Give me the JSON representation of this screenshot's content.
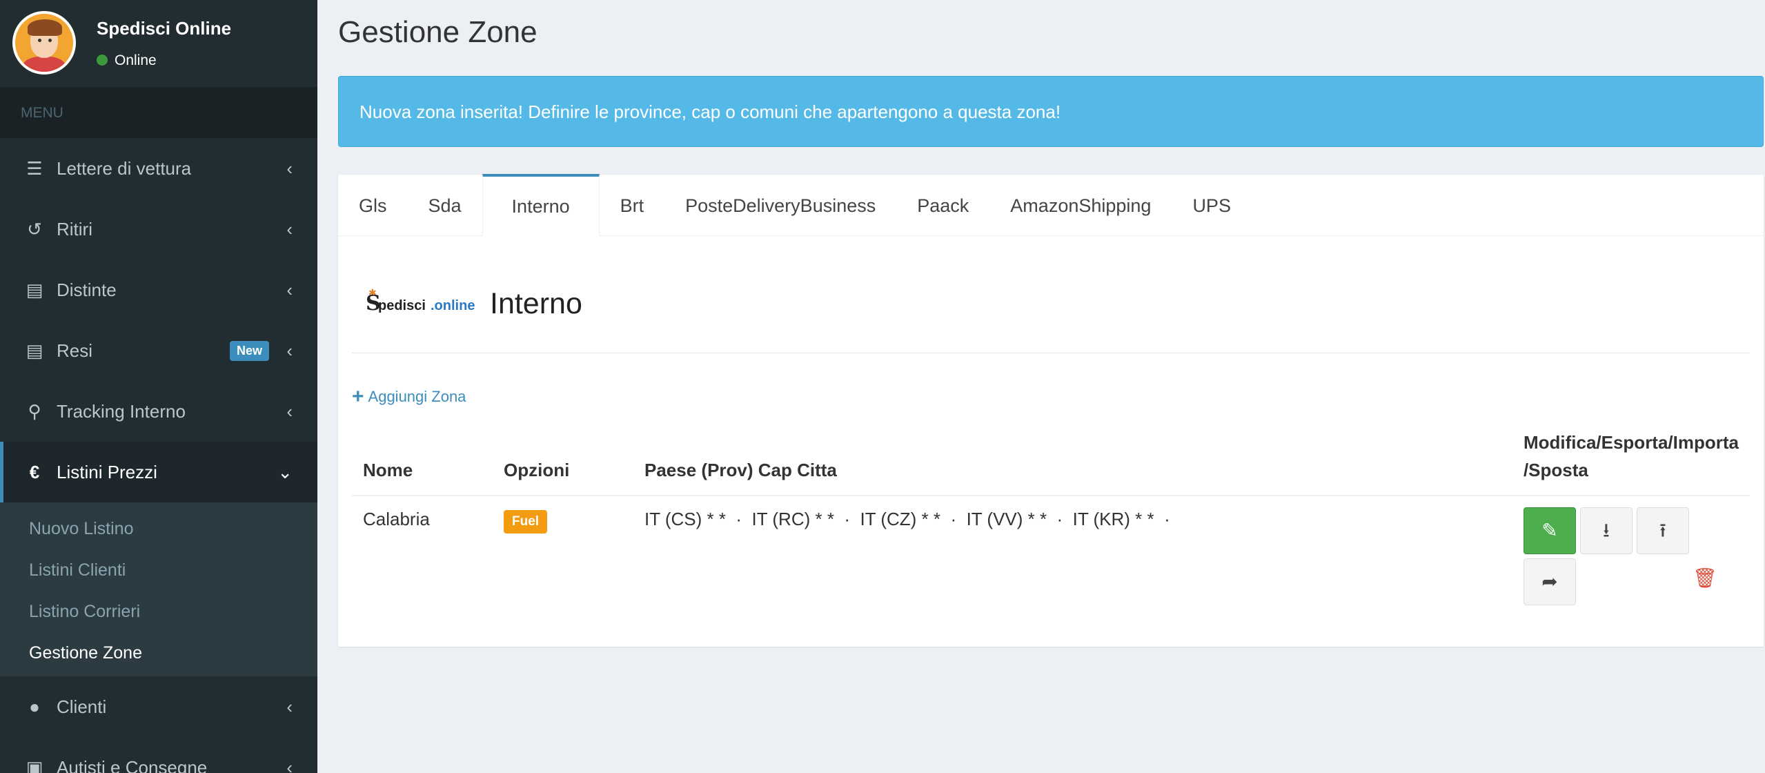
{
  "user": {
    "name": "Spedisci Online",
    "status": "Online"
  },
  "sidebar": {
    "menu_header": "MENU",
    "items": [
      {
        "label": "Lettere di vettura",
        "icon": "list-indent-icon"
      },
      {
        "label": "Ritiri",
        "icon": "undo-icon"
      },
      {
        "label": "Distinte",
        "icon": "list-alt-icon"
      },
      {
        "label": "Resi",
        "icon": "list-alt-icon",
        "badge": "New"
      },
      {
        "label": "Tracking Interno",
        "icon": "map-marker-icon"
      },
      {
        "label": "Listini Prezzi",
        "icon": "euro-icon"
      }
    ],
    "submenu": [
      "Nuovo Listino",
      "Listini Clienti",
      "Listino Corrieri",
      "Gestione Zone"
    ],
    "items_after": [
      {
        "label": "Clienti",
        "icon": "user-icon"
      },
      {
        "label": "Autisti e Consegne",
        "icon": "bus-icon"
      }
    ]
  },
  "page": {
    "title": "Gestione Zone"
  },
  "alert": {
    "text": "Nuova zona inserita! Definire le province, cap o comuni che apartengono a questa zona!"
  },
  "tabs": [
    "Gls",
    "Sda",
    "Interno",
    "Brt",
    "PosteDeliveryBusiness",
    "Paack",
    "AmazonShipping",
    "UPS"
  ],
  "active_tab": "Interno",
  "carrier": {
    "logo": {
      "s": "S",
      "text1": "pedisci",
      "text2": ".online"
    },
    "title": "Interno"
  },
  "add_zone_label": "Aggiungi Zona",
  "table": {
    "headers": [
      "Nome",
      "Opzioni",
      "Paese (Prov) Cap Citta",
      "Modifica/Esporta/Importa /Sposta"
    ],
    "rows": [
      {
        "nome": "Calabria",
        "opzione": "Fuel",
        "aree": "IT (CS) * *  ·  IT (RC) * *  ·  IT (CZ) * *  ·  IT (VV) * *  ·  IT (KR) * *  ·"
      }
    ]
  },
  "colors": {
    "sidebar": "#222d32",
    "accent": "#3c8dbc",
    "alert": "#55b9e8",
    "edit_button": "#4cae4c",
    "fuel_badge": "#f39c12",
    "delete": "#dd4b39"
  }
}
